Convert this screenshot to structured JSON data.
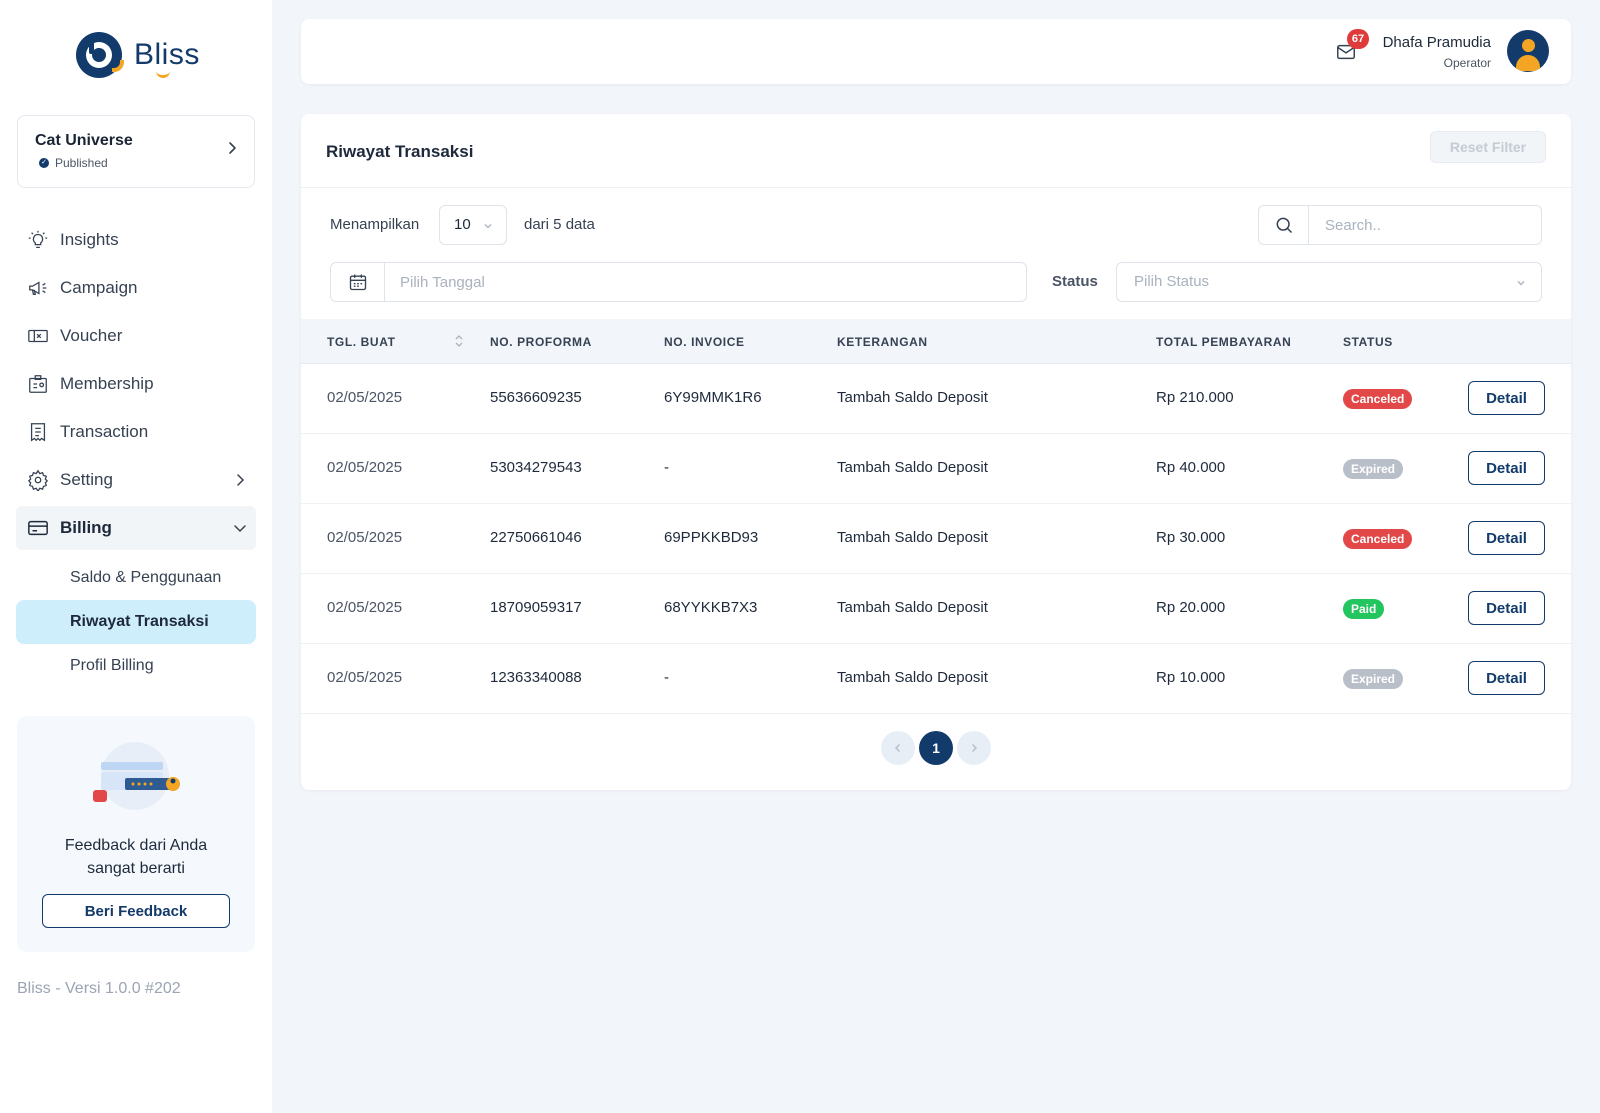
{
  "app": {
    "brand": "Bliss",
    "version_label": "Bliss - Versi 1.0.0 #202"
  },
  "project": {
    "name": "Cat Universe",
    "status": "Published"
  },
  "sidebar": {
    "items": [
      {
        "label": "Insights",
        "icon": "lightbulb-icon"
      },
      {
        "label": "Campaign",
        "icon": "megaphone-icon"
      },
      {
        "label": "Voucher",
        "icon": "voucher-icon"
      },
      {
        "label": "Membership",
        "icon": "membership-icon"
      },
      {
        "label": "Transaction",
        "icon": "receipt-icon"
      },
      {
        "label": "Setting",
        "icon": "gear-icon"
      },
      {
        "label": "Billing",
        "icon": "billing-icon"
      }
    ],
    "billing_sub": [
      {
        "label": "Saldo & Penggunaan"
      },
      {
        "label": "Riwayat Transaksi"
      },
      {
        "label": "Profil Billing"
      }
    ]
  },
  "feedback": {
    "text_line1": "Feedback dari Anda",
    "text_line2": "sangat berarti",
    "button": "Beri Feedback"
  },
  "header": {
    "notification_count": "67",
    "user_name": "Dhafa Pramudia",
    "user_role": "Operator"
  },
  "page": {
    "title": "Riwayat Transaksi",
    "reset_filter": "Reset Filter",
    "show_label": "Menampilkan",
    "page_size": "10",
    "of_label": "dari 5 data",
    "search_placeholder": "Search..",
    "date_placeholder": "Pilih Tanggal",
    "status_label": "Status",
    "status_placeholder": "Pilih Status"
  },
  "table": {
    "columns": [
      "TGL. BUAT",
      "NO. PROFORMA",
      "NO. INVOICE",
      "KETERANGAN",
      "TOTAL PEMBAYARAN",
      "STATUS"
    ],
    "detail_label": "Detail",
    "rows": [
      {
        "date": "02/05/2025",
        "proforma": "55636609235",
        "invoice": "6Y99MMK1R6",
        "desc": "Tambah Saldo Deposit",
        "total": "Rp 210.000",
        "status": "Canceled"
      },
      {
        "date": "02/05/2025",
        "proforma": "53034279543",
        "invoice": "-",
        "desc": "Tambah Saldo Deposit",
        "total": "Rp 40.000",
        "status": "Expired"
      },
      {
        "date": "02/05/2025",
        "proforma": "22750661046",
        "invoice": "69PPKKBD93",
        "desc": "Tambah Saldo Deposit",
        "total": "Rp 30.000",
        "status": "Canceled"
      },
      {
        "date": "02/05/2025",
        "proforma": "18709059317",
        "invoice": "68YYKKB7X3",
        "desc": "Tambah Saldo Deposit",
        "total": "Rp 20.000",
        "status": "Paid"
      },
      {
        "date": "02/05/2025",
        "proforma": "12363340088",
        "invoice": "-",
        "desc": "Tambah Saldo Deposit",
        "total": "Rp 10.000",
        "status": "Expired"
      }
    ]
  },
  "pagination": {
    "current": "1"
  },
  "colors": {
    "brand": "#123a6b",
    "accent": "#f4a524",
    "canceled": "#e34848",
    "expired": "#b9bfc8",
    "paid": "#22c55e",
    "active_sub": "#cfeefc"
  }
}
